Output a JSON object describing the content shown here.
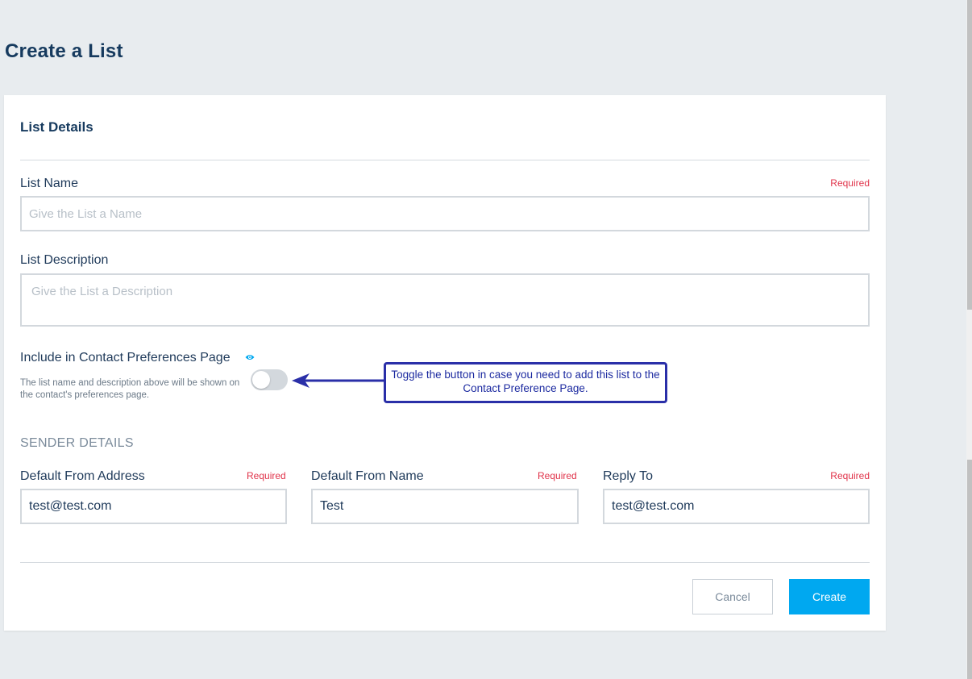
{
  "page": {
    "title": "Create a List"
  },
  "list_details": {
    "section_title": "List Details",
    "list_name": {
      "label": "List Name",
      "required": "Required",
      "placeholder": "Give the List a Name"
    },
    "list_description": {
      "label": "List Description",
      "placeholder": "Give the List a Description"
    },
    "preferences": {
      "label": "Include in Contact Preferences Page",
      "help_text": "The list name and description above will be shown on the contact's preferences page.",
      "toggle_on": false
    }
  },
  "sender_details": {
    "section_title": "SENDER DETAILS",
    "from_address": {
      "label": "Default From Address",
      "required": "Required",
      "value": "test@test.com"
    },
    "from_name": {
      "label": "Default From Name",
      "required": "Required",
      "value": "Test"
    },
    "reply_to": {
      "label": "Reply To",
      "required": "Required",
      "value": "test@test.com"
    }
  },
  "actions": {
    "cancel_label": "Cancel",
    "create_label": "Create"
  },
  "annotation": {
    "text": "Toggle the button in case you need to add this list to the Contact Preference Page."
  },
  "colors": {
    "primary": "#00a8f0",
    "required": "#e0334a",
    "heading": "#163a5e",
    "annotation": "#2a2fa8"
  }
}
